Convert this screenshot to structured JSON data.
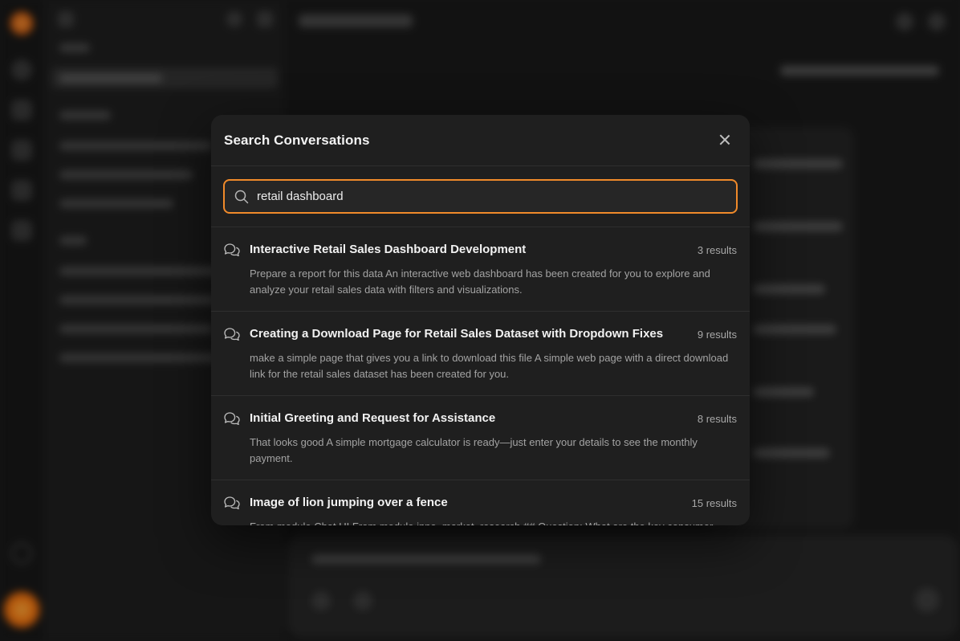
{
  "modal": {
    "title": "Search Conversations",
    "search": {
      "value": "retail dashboard",
      "placeholder": ""
    },
    "results": [
      {
        "title": "Interactive Retail Sales Dashboard Development",
        "count": "3 results",
        "snippet": "Prepare a report for this data An interactive web dashboard has been created for you to explore and analyze your retail sales data with filters and visualizations."
      },
      {
        "title": "Creating a Download Page for Retail Sales Dataset with Dropdown Fixes",
        "count": "9 results",
        "snippet": "make a simple page that gives you a link to download this file A simple web page with a direct download link for the retail sales dataset has been created for you."
      },
      {
        "title": "Initial Greeting and Request for Assistance",
        "count": "8 results",
        "snippet": "That looks good A simple mortgage calculator is ready—just enter your details to see the monthly payment."
      },
      {
        "title": "Image of lion jumping over a fence",
        "count": "15 results",
        "snippet": "From module Chat UI From module inno_market_research ## Question: What are the key consumer"
      }
    ]
  },
  "colors": {
    "accent": "#f08a2a",
    "modal_bg": "#1f1f1f",
    "page_bg": "#1c1c1c"
  },
  "icons": {
    "close": "close-icon",
    "search": "search-icon",
    "result": "chat-bubbles-icon"
  }
}
